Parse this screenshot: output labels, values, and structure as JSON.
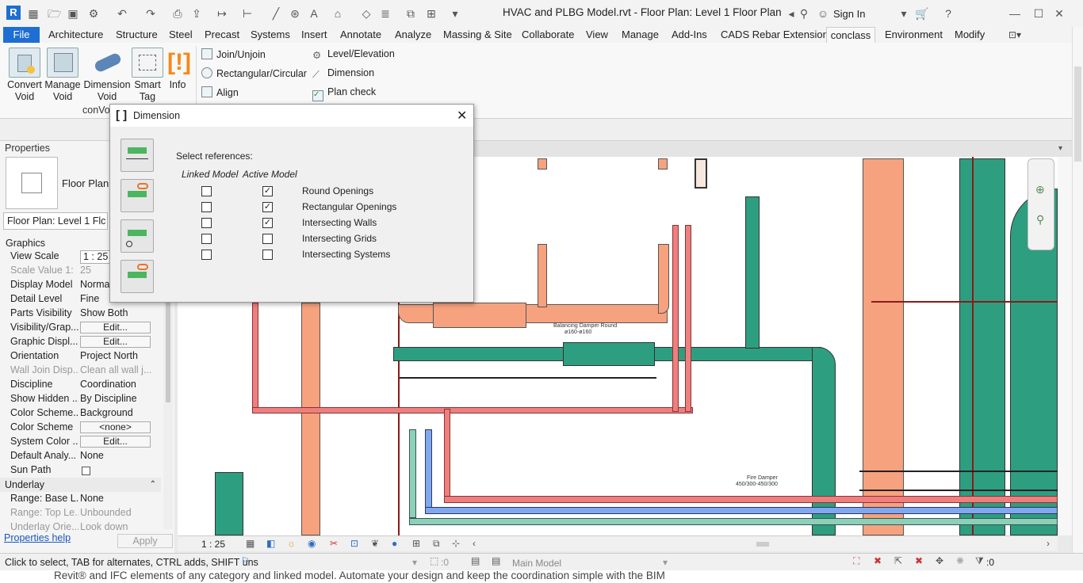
{
  "window": {
    "title": "HVAC and PLBG Model.rvt - Floor Plan: Level 1 Floor Plan",
    "sign_in": "Sign In",
    "app_icon_letter": "R"
  },
  "ribbon": {
    "tabs": [
      "File",
      "Architecture",
      "Structure",
      "Steel",
      "Precast",
      "Systems",
      "Insert",
      "Annotate",
      "Analyze",
      "Massing & Site",
      "Collaborate",
      "View",
      "Manage",
      "Add-Ins",
      "CADS Rebar Extensions",
      "conclass",
      "Environment",
      "Modify"
    ],
    "active_tab": "conclass",
    "big_buttons": [
      {
        "label1": "Convert",
        "label2": "Void"
      },
      {
        "label1": "Manage",
        "label2": "Void"
      },
      {
        "label1": "Dimension",
        "label2": "Void"
      },
      {
        "label1": "Smart",
        "label2": "Tag"
      },
      {
        "label1": "Info",
        "label2": ""
      }
    ],
    "small_buttons_col1": [
      "Join/Unjoin",
      "Rectangular/Circular",
      "Align"
    ],
    "small_buttons_col2": [
      "Level/Elevation",
      "Dimension",
      "Plan check"
    ],
    "panel_label": "conVo"
  },
  "properties": {
    "header": "Properties",
    "type_name": "Floor Plan",
    "instance_selector": "Floor Plan: Level 1 Flc",
    "section_graphics": "Graphics",
    "rows": [
      {
        "label": "View Scale",
        "value": "1 : 25"
      },
      {
        "label": "Scale Value    1:",
        "value": "25"
      },
      {
        "label": "Display Model",
        "value": "Normal"
      },
      {
        "label": "Detail Level",
        "value": "Fine"
      },
      {
        "label": "Parts Visibility",
        "value": "Show Both"
      },
      {
        "label": "Visibility/Grap...",
        "value": "Edit..."
      },
      {
        "label": "Graphic Displ...",
        "value": "Edit..."
      },
      {
        "label": "Orientation",
        "value": "Project North"
      },
      {
        "label": "Wall Join Disp...",
        "value": "Clean all wall j..."
      },
      {
        "label": "Discipline",
        "value": "Coordination"
      },
      {
        "label": "Show Hidden ...",
        "value": "By Discipline"
      },
      {
        "label": "Color Scheme...",
        "value": "Background"
      },
      {
        "label": "Color Scheme",
        "value": "<none>"
      },
      {
        "label": "System Color ...",
        "value": "Edit..."
      },
      {
        "label": "Default Analy...",
        "value": "None"
      },
      {
        "label": "Sun Path",
        "value": ""
      }
    ],
    "section_underlay": "Underlay",
    "underlay_rows": [
      {
        "label": "Range: Base L...",
        "value": "None"
      },
      {
        "label": "Range: Top Le...",
        "value": "Unbounded"
      },
      {
        "label": "Underlay Orie...",
        "value": "Look down"
      }
    ],
    "help_link": "Properties help",
    "apply_button": "Apply"
  },
  "dialog": {
    "title": "Dimension",
    "prompt": "Select references:",
    "col_linked": "Linked Model",
    "col_active": "Active Model",
    "options": [
      {
        "label": "Round Openings",
        "linked": false,
        "active": true
      },
      {
        "label": "Rectangular Openings",
        "linked": false,
        "active": true
      },
      {
        "label": "Intersecting Walls",
        "linked": false,
        "active": true
      },
      {
        "label": "Intersecting Grids",
        "linked": false,
        "active": false
      },
      {
        "label": "Intersecting Systems",
        "linked": false,
        "active": false
      }
    ]
  },
  "canvas": {
    "annotation1_line1": "Balancing Damper Round",
    "annotation1_line2": "ø160-ø160",
    "annotation2_line1": "Fire Damper",
    "annotation2_line2": "450/300-450/300",
    "colors": {
      "duct_orange": "#f7a27e",
      "duct_teal": "#2e9e80",
      "pipe_red": "#ef7f7f",
      "pipe_blue": "#7fa8f0",
      "pipe_sea": "#8ecfb8",
      "grid_red": "#8b1a1a"
    }
  },
  "viewbar": {
    "scale": "1 : 25"
  },
  "status": {
    "hint": "Click to select, TAB for alternates, CTRL adds, SHIFT uns",
    "workset": ":0",
    "model": "Main Model",
    "filter_count": ":0"
  },
  "web_text": "Revit® and IFC elements of any category and linked model. Automate your design and keep the coordination simple with the BIM"
}
